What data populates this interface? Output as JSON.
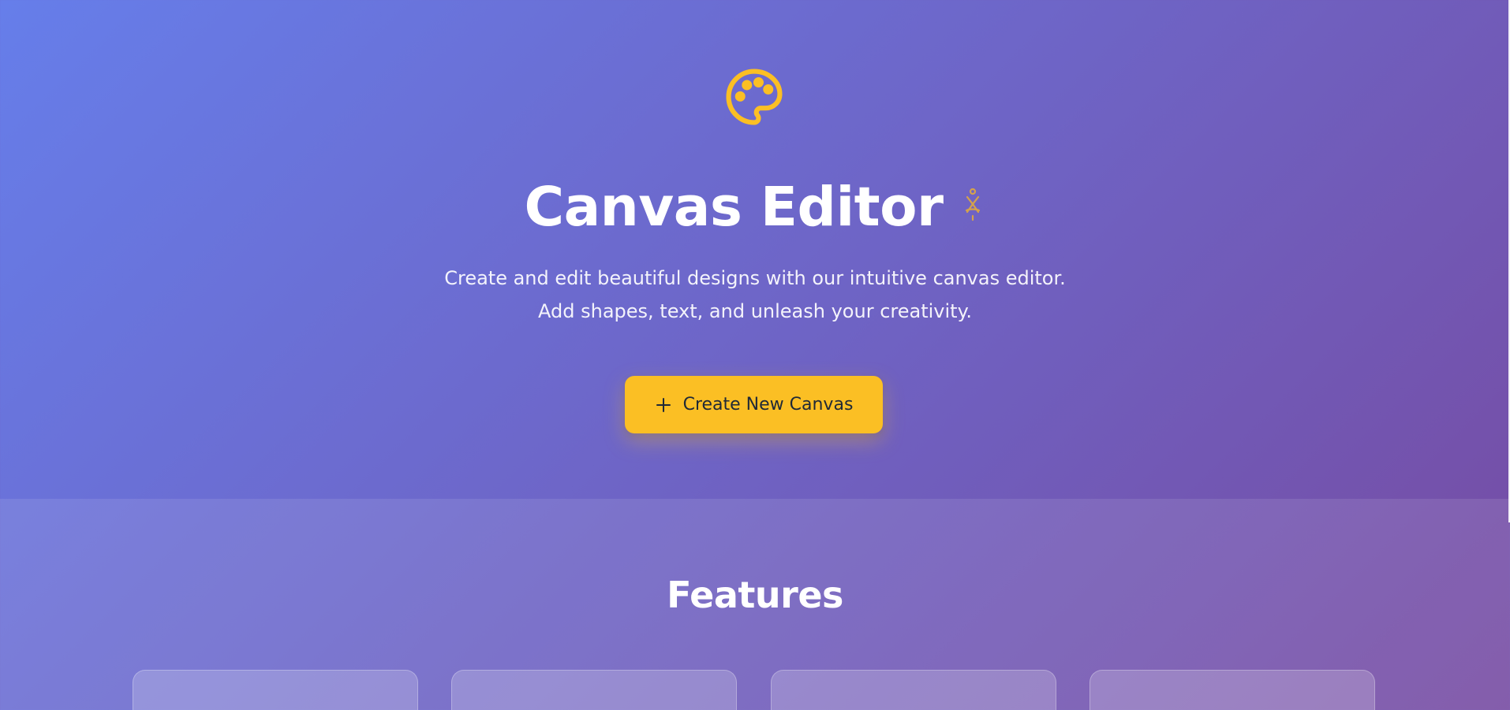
{
  "hero": {
    "logo_icon": "palette-icon",
    "title": "Canvas Editor",
    "title_decoration_icon": "sparkle-icon",
    "subtitle_line1": "Create and edit beautiful designs with our intuitive canvas editor.",
    "subtitle_line2": "Add shapes, text, and unleash your creativity.",
    "cta_icon": "plus-icon",
    "cta_label": "Create New Canvas"
  },
  "features": {
    "title": "Features",
    "cards": [
      {},
      {},
      {},
      {}
    ]
  },
  "colors": {
    "gradient_start": "#667eea",
    "gradient_end": "#764ba2",
    "accent": "#fbbf24",
    "button_text": "#1f2937",
    "text": "#ffffff"
  }
}
